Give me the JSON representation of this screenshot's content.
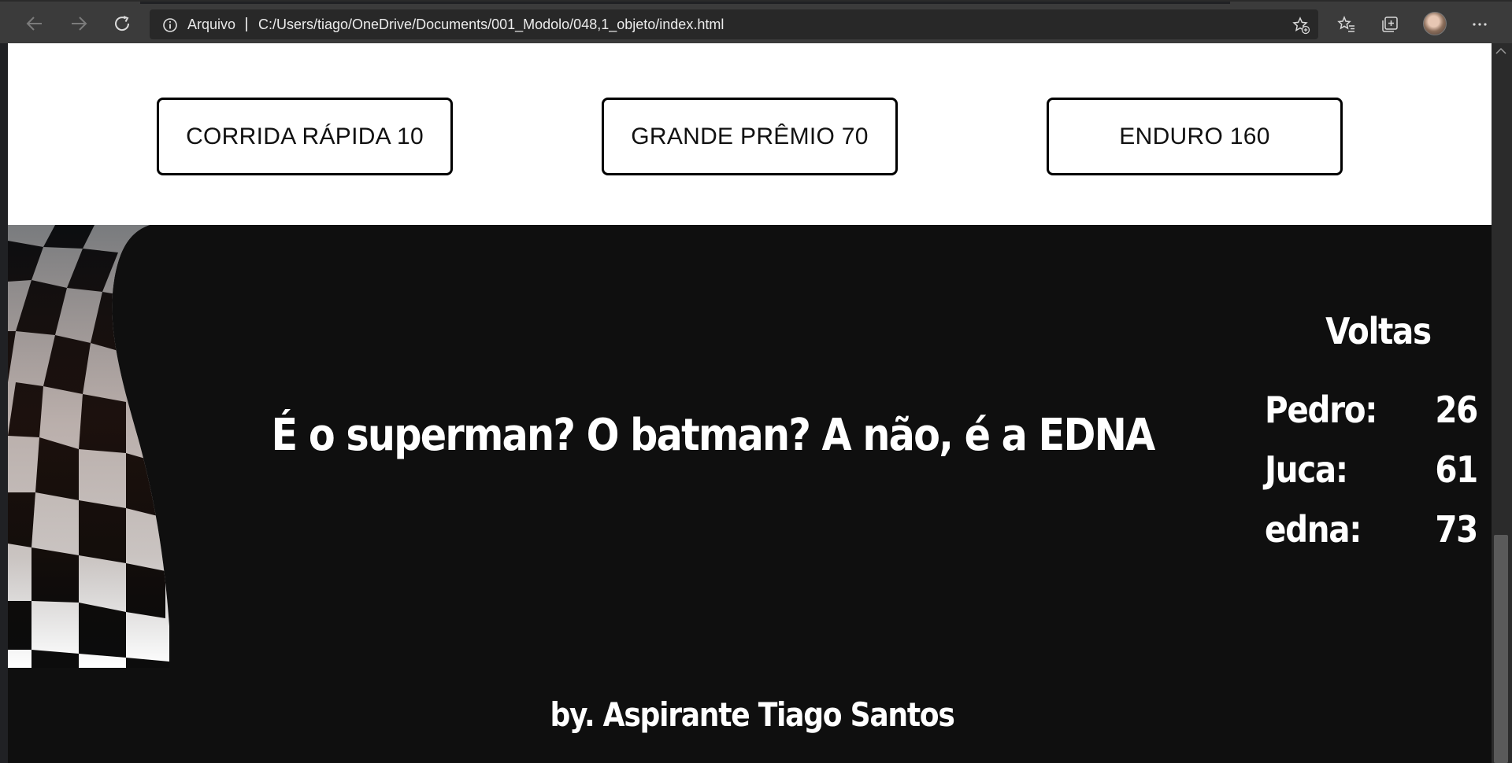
{
  "browser": {
    "origin_label": "Arquivo",
    "url": "C:/Users/tiago/OneDrive/Documents/001_Modolo/048,1_objeto/index.html",
    "icons": [
      "back-icon",
      "forward-icon",
      "refresh-icon",
      "info-icon",
      "add-favorite-icon",
      "favorites-icon",
      "collections-icon",
      "profile-avatar",
      "more-icon"
    ],
    "accent": "#3b3b3b"
  },
  "page": {
    "race_buttons": [
      {
        "label": "CORRIDA RÁPIDA 10"
      },
      {
        "label": "GRANDE PRÊMIO 70"
      },
      {
        "label": "ENDURO 160"
      }
    ],
    "message": "É o superman? O batman? A não, é a EDNA",
    "laps": {
      "title": "Voltas",
      "rows": [
        {
          "name": "Pedro:",
          "count": "26"
        },
        {
          "name": "Juca:",
          "count": "61"
        },
        {
          "name": "edna:",
          "count": "73"
        }
      ]
    },
    "credit": "by. Aspirante Tiago Santos",
    "colors": {
      "dark_bg": "#0f0f0f",
      "text": "#ffffff",
      "button_border": "#000000"
    }
  }
}
